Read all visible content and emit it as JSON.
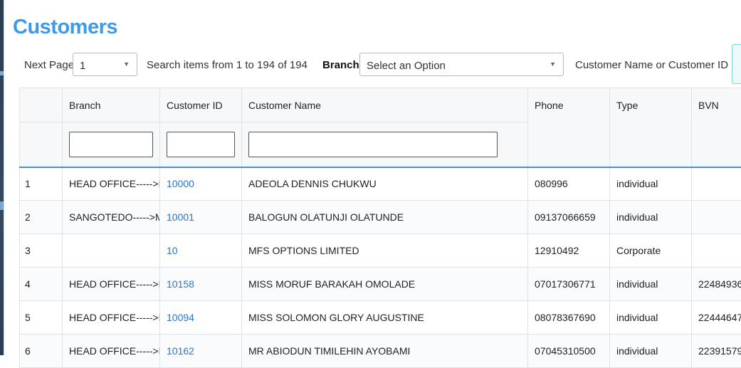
{
  "page": {
    "title": "Customers"
  },
  "toolbar": {
    "next_page_label": "Next Page",
    "page_value": "1",
    "search_items_label": "Search items from 1 to 194 of 194",
    "branch_label": "Branch",
    "branch_select_value": "Select an Option",
    "customer_search_label": "Customer Name or Customer ID"
  },
  "table": {
    "columns": {
      "index": "",
      "branch": "Branch",
      "customer_id": "Customer ID",
      "customer_name": "Customer Name",
      "phone": "Phone",
      "type": "Type",
      "bvn": "BVN"
    },
    "rows": [
      {
        "index": "1",
        "branch": "HEAD OFFICE----->MA",
        "customer_id": "10000",
        "customer_name": "ADEOLA DENNIS CHUKWU",
        "phone": "080996",
        "type": "individual",
        "bvn": ""
      },
      {
        "index": "2",
        "branch": "SANGOTEDO----->MA",
        "customer_id": "10001",
        "customer_name": "BALOGUN OLATUNJI OLATUNDE",
        "phone": "09137066659",
        "type": "individual",
        "bvn": ""
      },
      {
        "index": "3",
        "branch": "",
        "customer_id": "10",
        "customer_name": "MFS OPTIONS LIMITED",
        "phone": "12910492",
        "type": "Corporate",
        "bvn": ""
      },
      {
        "index": "4",
        "branch": "HEAD OFFICE----->MI",
        "customer_id": "10158",
        "customer_name": "MISS MORUF BARAKAH OMOLADE",
        "phone": "07017306771",
        "type": "individual",
        "bvn": "22484936"
      },
      {
        "index": "5",
        "branch": "HEAD OFFICE----->MA",
        "customer_id": "10094",
        "customer_name": "MISS SOLOMON GLORY AUGUSTINE",
        "phone": "08078367690",
        "type": "individual",
        "bvn": "22444647"
      },
      {
        "index": "6",
        "branch": "HEAD OFFICE----->MI",
        "customer_id": "10162",
        "customer_name": "MR ABIODUN TIMILEHIN AYOBAMI",
        "phone": "07045310500",
        "type": "individual",
        "bvn": "22391579"
      }
    ]
  },
  "colors": {
    "accent": "#3c9ae8",
    "link": "#2a74c4",
    "header_rule": "#4a90c8"
  },
  "icons": {
    "dropdown": "chevron-down-icon"
  }
}
